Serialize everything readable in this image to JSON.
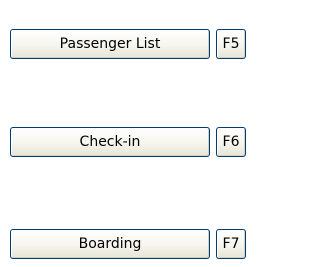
{
  "buttons": [
    {
      "label": "Passenger List",
      "key": "F5"
    },
    {
      "label": "Check-in",
      "key": "F6"
    },
    {
      "label": "Boarding",
      "key": "F7"
    }
  ]
}
